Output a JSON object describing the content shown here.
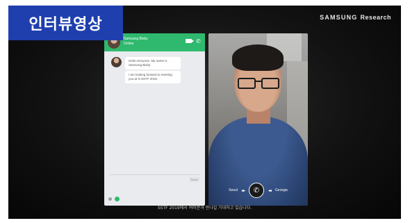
{
  "badge": {
    "title": "인터뷰영상"
  },
  "brand": {
    "name": "SAMSUNG",
    "division": "Research"
  },
  "chat": {
    "header_name": "Samsung Bixby",
    "header_status": "Online",
    "messages": [
      "Hello everyone. My name is Samsung Bixby.",
      "I am looking forward to meeting you at S-SSTF 2019."
    ],
    "send_label": "Send"
  },
  "video_call": {
    "left_label": "Seoul",
    "right_label": "Georgia"
  },
  "caption": "SSTF 2019에서 여러분과 만나길 기대하고 있습니다."
}
